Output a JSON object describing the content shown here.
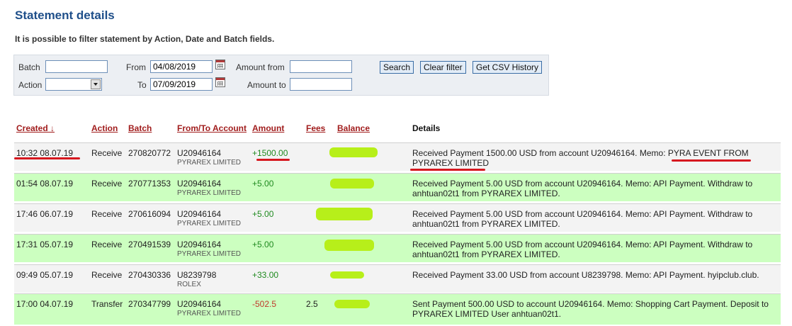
{
  "page": {
    "title": "Statement details",
    "description": "It is possible to filter statement by Action, Date and Batch fields."
  },
  "filter": {
    "batch_label": "Batch",
    "batch_value": "",
    "action_label": "Action",
    "action_value": "",
    "from_label": "From",
    "from_value": "04/08/2019",
    "to_label": "To",
    "to_value": "07/09/2019",
    "amount_from_label": "Amount from",
    "amount_from_value": "",
    "amount_to_label": "Amount to",
    "amount_to_value": "",
    "search_label": "Search",
    "clear_label": "Clear filter",
    "csv_label": "Get CSV History"
  },
  "table": {
    "headers": {
      "created": "Created ↓",
      "action": "Action",
      "batch": "Batch",
      "account": "From/To Account",
      "amount": "Amount",
      "fees": "Fees",
      "balance": "Balance",
      "details": "Details"
    },
    "rows": [
      {
        "created": "10:32 08.07.19",
        "action": "Receive",
        "batch": "270820772",
        "account": "U20946164",
        "account_name": "PYRAREX LIMITED",
        "amount": "+1500.00",
        "fees": "",
        "details": "Received Payment 1500.00 USD from account U20946164. Memo: PYRA EVENT FROM PYRAREX LIMITED"
      },
      {
        "created": "01:54 08.07.19",
        "action": "Receive",
        "batch": "270771353",
        "account": "U20946164",
        "account_name": "PYRAREX LIMITED",
        "amount": "+5.00",
        "fees": "",
        "details": "Received Payment 5.00 USD from account U20946164. Memo: API Payment. Withdraw to anhtuan02t1 from PYRAREX LIMITED."
      },
      {
        "created": "17:46 06.07.19",
        "action": "Receive",
        "batch": "270616094",
        "account": "U20946164",
        "account_name": "PYRAREX LIMITED",
        "amount": "+5.00",
        "fees": "",
        "details": "Received Payment 5.00 USD from account U20946164. Memo: API Payment. Withdraw to anhtuan02t1 from PYRAREX LIMITED."
      },
      {
        "created": "17:31 05.07.19",
        "action": "Receive",
        "batch": "270491539",
        "account": "U20946164",
        "account_name": "PYRAREX LIMITED",
        "amount": "+5.00",
        "fees": "",
        "details": "Received Payment 5.00 USD from account U20946164. Memo: API Payment. Withdraw to anhtuan02t1 from PYRAREX LIMITED."
      },
      {
        "created": "09:49 05.07.19",
        "action": "Receive",
        "batch": "270430336",
        "account": "U8239798",
        "account_name": "ROLEX",
        "amount": "+33.00",
        "fees": "",
        "details": "Received Payment 33.00 USD from account U8239798. Memo: API Payment. hyipclub.club."
      },
      {
        "created": "17:00 04.07.19",
        "action": "Transfer",
        "batch": "270347799",
        "account": "U20946164",
        "account_name": "PYRAREX LIMITED",
        "amount": "-502.5",
        "fees": "2.5",
        "details": "Sent Payment 500.00 USD to account U20946164. Memo: Shopping Cart Payment. Deposit to PYRAREX LIMITED User anhtuan02t1."
      }
    ]
  },
  "colors": {
    "title": "#1f4f8a",
    "header_link": "#a11d1d",
    "row_green": "#ccffc0",
    "positive": "#1f8a1f",
    "negative": "#c0392b",
    "annotation_underline": "#d6181f",
    "redaction": "#b7ef1a"
  },
  "icons": [
    "calendar-icon",
    "dropdown-arrow-icon",
    "sort-down-icon"
  ]
}
